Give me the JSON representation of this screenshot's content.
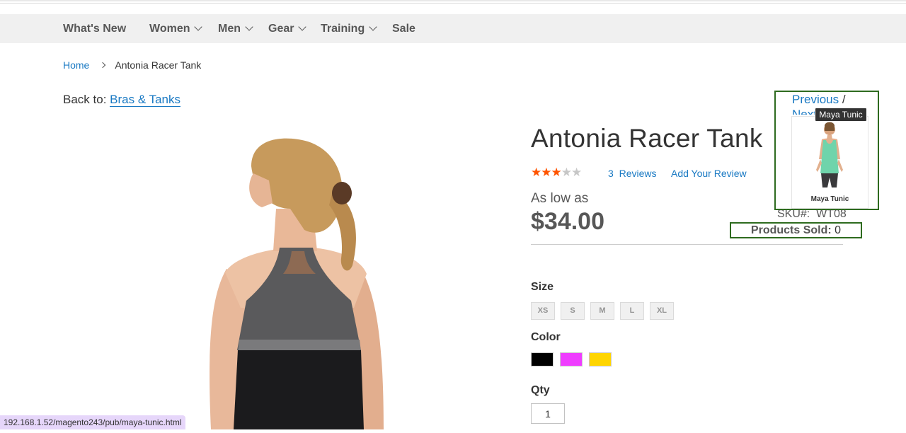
{
  "nav": {
    "items": [
      {
        "label": "What's New",
        "has_dropdown": false
      },
      {
        "label": "Women",
        "has_dropdown": true
      },
      {
        "label": "Men",
        "has_dropdown": true
      },
      {
        "label": "Gear",
        "has_dropdown": true
      },
      {
        "label": "Training",
        "has_dropdown": true
      },
      {
        "label": "Sale",
        "has_dropdown": false
      }
    ]
  },
  "breadcrumb": {
    "home": "Home",
    "current": "Antonia Racer Tank"
  },
  "back_to": {
    "prefix": "Back to:",
    "link": "Bras & Tanks"
  },
  "product": {
    "title": "Antonia Racer Tank",
    "rating": 3,
    "rating_max": 5,
    "reviews_count": "3",
    "reviews_label": "Reviews",
    "add_review": "Add Your Review",
    "as_low_as": "As low as",
    "price": "$34.00",
    "sku_label": "SKU#:",
    "sku": "WT08",
    "sold_label": "Products Sold:",
    "sold_value": "0"
  },
  "options": {
    "size_label": "Size",
    "sizes": [
      "XS",
      "S",
      "M",
      "L",
      "XL"
    ],
    "color_label": "Color",
    "colors": [
      "#000000",
      "#ef3dff",
      "#ffd500"
    ],
    "qty_label": "Qty",
    "qty": "1"
  },
  "prev_next": {
    "previous": "Previous",
    "separator": "/",
    "next": "Next",
    "tooltip": "Maya Tunic",
    "preview_name": "Maya Tunic"
  },
  "status_url": "192.168.1.52/magento243/pub/maya-tunic.html"
}
